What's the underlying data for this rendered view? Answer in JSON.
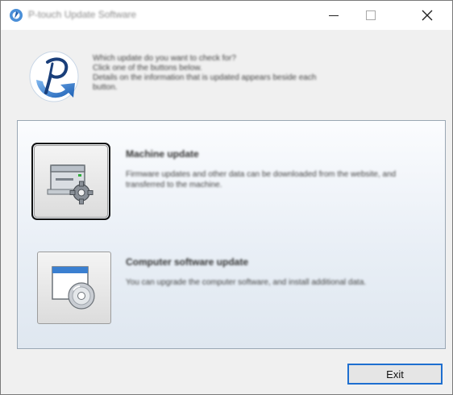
{
  "window": {
    "title": "P-touch Update Software",
    "controls": {
      "minimize": "minimize-icon",
      "maximize": "maximize-icon",
      "close": "close-icon"
    }
  },
  "intro": {
    "lines": [
      "Which update do you want to check for?",
      "Click one of the buttons below.",
      "Details on the information that is updated appears beside each",
      "button."
    ]
  },
  "options": [
    {
      "icon": "machine-settings-icon",
      "title": "Machine update",
      "description": "Firmware updates and other data can be downloaded from the website, and transferred to the machine."
    },
    {
      "icon": "computer-software-cd-icon",
      "title": "Computer software update",
      "description": "You can upgrade the computer software, and install additional data."
    }
  ],
  "footer": {
    "exit_label": "Exit"
  }
}
